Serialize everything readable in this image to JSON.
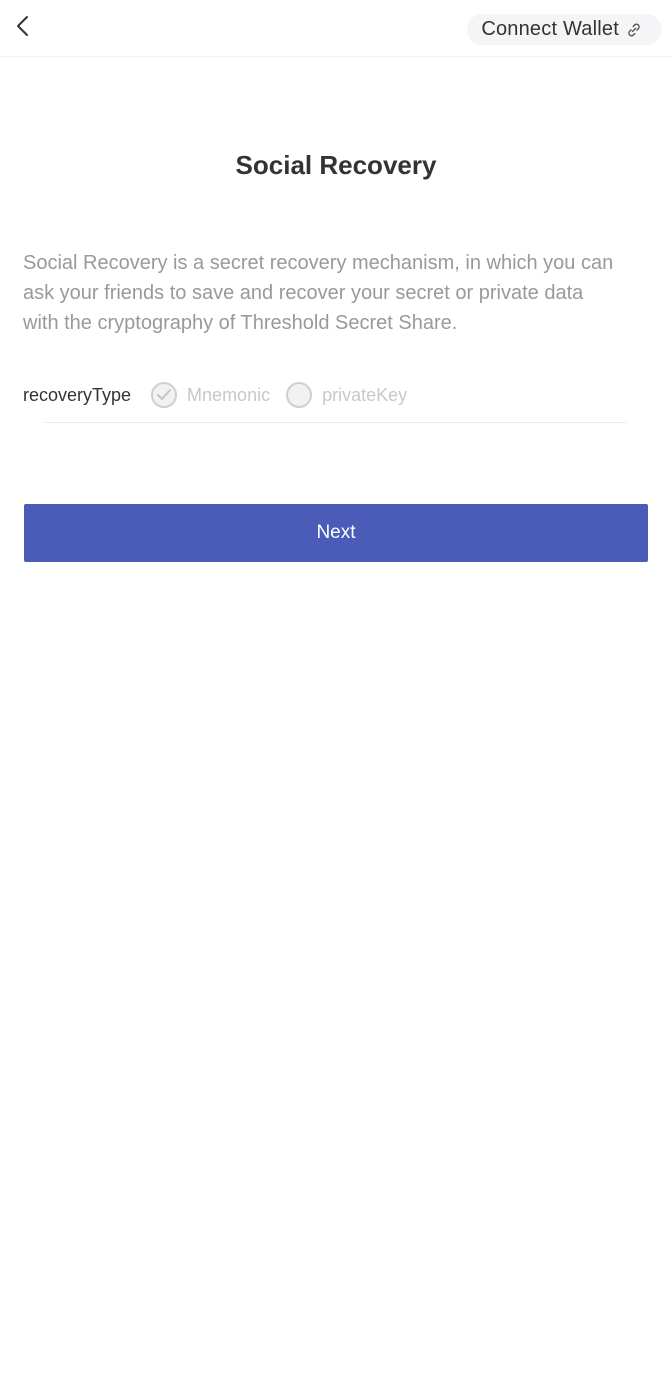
{
  "header": {
    "back_icon": "chevron-left-icon",
    "connect_label": "Connect Wallet",
    "connect_icon": "link-icon"
  },
  "main": {
    "title": "Social Recovery",
    "description": "Social Recovery is a secret recovery mechanism, in which you can ask your friends to save and recover your secret or private data with the cryptography of Threshold Secret Share.",
    "recovery_type": {
      "label": "recoveryType",
      "options": [
        {
          "label": "Mnemonic",
          "selected": true
        },
        {
          "label": "privateKey",
          "selected": false
        }
      ]
    },
    "next_label": "Next"
  },
  "colors": {
    "primary": "#4a5bb8",
    "text": "#333333",
    "muted": "#999999",
    "disabled": "#c8c8c8"
  }
}
